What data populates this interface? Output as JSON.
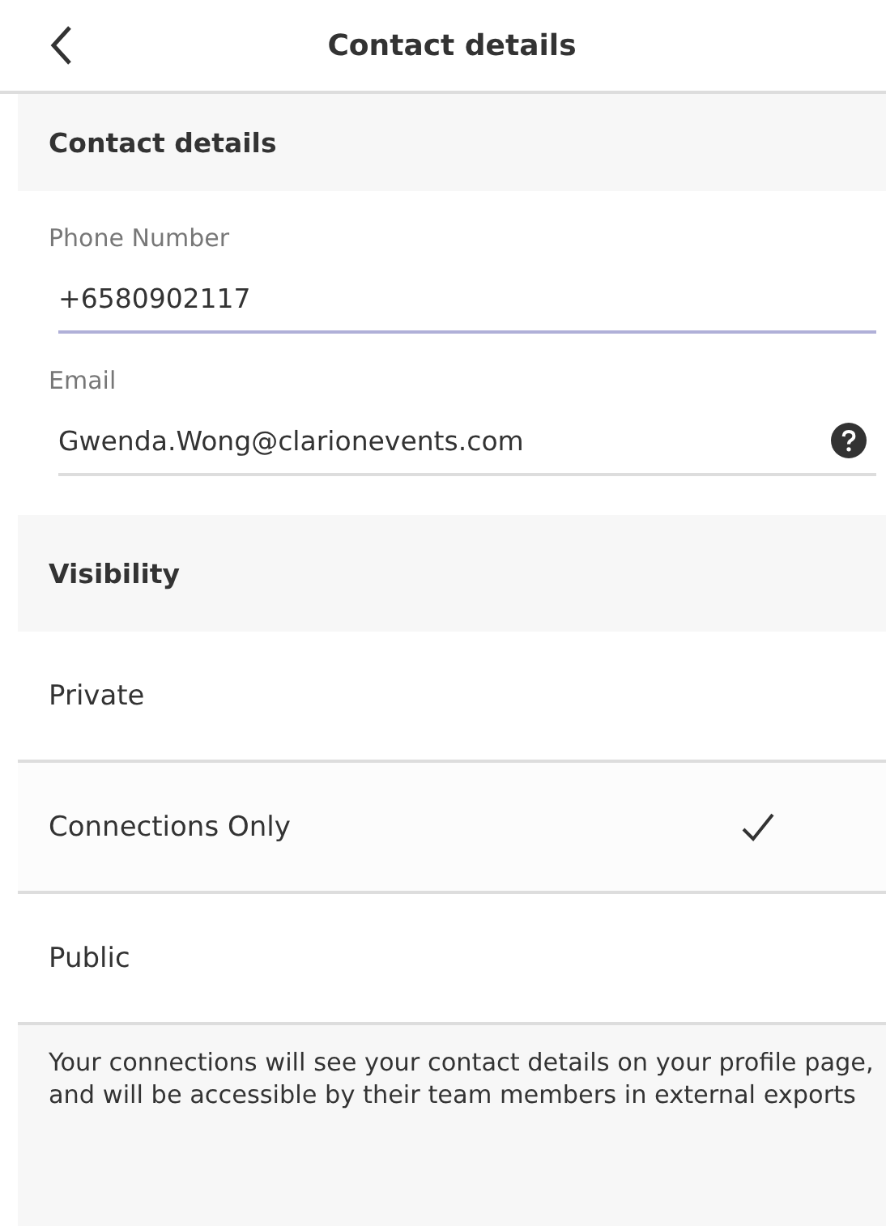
{
  "header": {
    "title": "Contact details"
  },
  "contact_section": {
    "title": "Contact details",
    "fields": [
      {
        "label": "Phone Number",
        "value": "+6580902117",
        "focused": true,
        "help": false
      },
      {
        "label": "Email",
        "value": "Gwenda.Wong@clarionevents.com",
        "focused": false,
        "help": true
      }
    ]
  },
  "visibility_section": {
    "title": "Visibility",
    "options": [
      {
        "label": "Private",
        "selected": false
      },
      {
        "label": "Connections Only",
        "selected": true
      },
      {
        "label": "Public",
        "selected": false
      }
    ]
  },
  "note": "Your connections will see your contact details on your profile page, and will be accessible by their team members in external exports"
}
